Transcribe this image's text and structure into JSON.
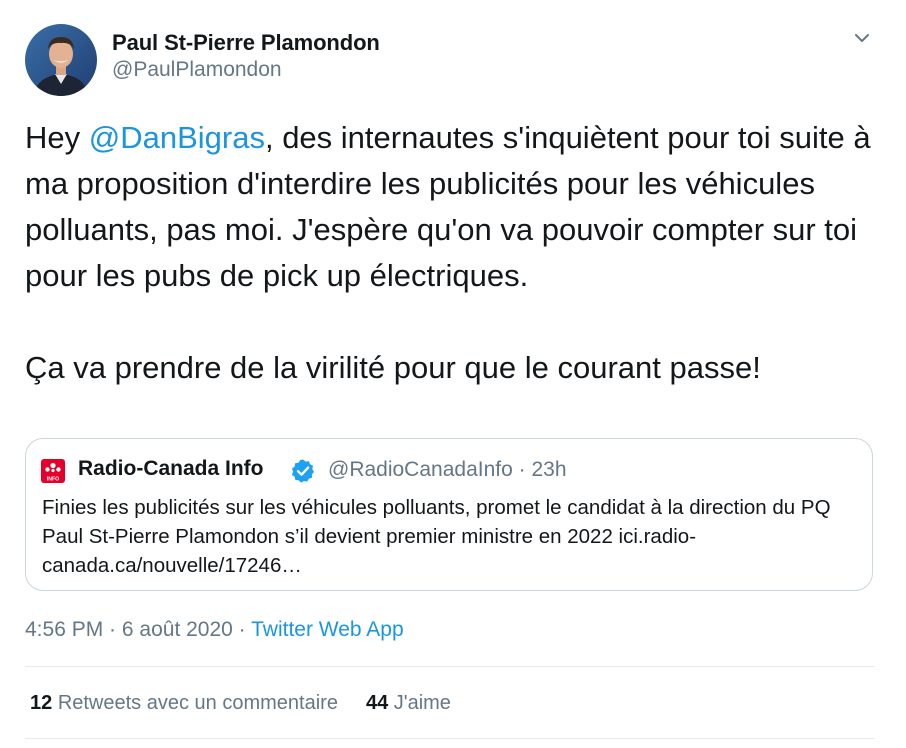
{
  "author": {
    "name": "Paul St-Pierre Plamondon",
    "handle": "@PaulPlamondon"
  },
  "tweet": {
    "part1_prefix": "Hey ",
    "mention": "@DanBigras",
    "part1_suffix": ", des internautes s'inquiètent pour toi suite à ma proposition d'interdire les publicités pour les véhicules polluants, pas moi. J'espère qu'on va pouvoir compter sur toi pour les pubs de pick up électriques.",
    "part2": "Ça va prendre de la virilité pour que le courant passe!"
  },
  "quoted": {
    "name": "Radio-Canada Info",
    "handle": "@RadioCanadaInfo",
    "separator": "·",
    "time": "23h",
    "logo_label": "INFO",
    "text": "Finies les publicités sur les véhicules polluants, promet le candidat à la direction du PQ Paul St-Pierre Plamondon s’il devient premier ministre en 2022 ici.radio-canada.ca/nouvelle/17246…"
  },
  "meta": {
    "time": "4:56 PM",
    "sep1": " · ",
    "date": "6 août 2020",
    "sep2": " · ",
    "source": "Twitter Web App"
  },
  "stats": {
    "retweets_count": "12",
    "retweets_label": "Retweets avec un commentaire",
    "likes_count": "44",
    "likes_label": "J'aime"
  },
  "colors": {
    "link": "#1b95e0",
    "secondary_text": "#657786",
    "border": "#ccd6dd",
    "radio_canada_red": "#e4002b",
    "verified": "#1da1f2"
  },
  "icons": {
    "menu": "chevron-down-icon",
    "verified": "verified-badge-icon",
    "logo": "radio-canada-logo-icon"
  }
}
